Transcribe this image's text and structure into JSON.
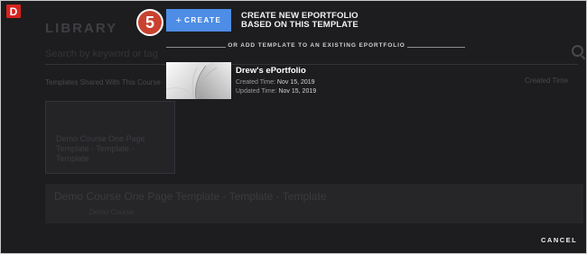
{
  "badge": {
    "letter": "D"
  },
  "step": {
    "number": "5"
  },
  "background": {
    "title": "LIBRARY",
    "search_placeholder": "Search by keyword or tag",
    "subheading": "Templates Shared With This Course",
    "sort_label": "Created Time",
    "card_title": "Demo Course One Page Template - Template - Template",
    "row_title": "Demo Course One Page Template - Template - Template",
    "row_subtitle": "Demo Course"
  },
  "create": {
    "plus": "+",
    "button_label": "CREATE",
    "description_line1": "CREATE NEW EPORTFOLIO",
    "description_line2": "BASED ON THIS TEMPLATE"
  },
  "divider": {
    "text": "OR ADD TEMPLATE TO AN EXISTING EPORTFOLIO"
  },
  "portfolio": {
    "name": "Drew's ePortfolio",
    "created_label": "Created Time:",
    "created_value": "Nov 15, 2019",
    "updated_label": "Updated Time:",
    "updated_value": "Nov 15, 2019"
  },
  "cancel_label": "CANCEL",
  "colors": {
    "accent_blue": "#4d8de6",
    "badge_red": "#d6231f",
    "step_red": "#c8422f",
    "overlay": "#1d1d1f"
  }
}
